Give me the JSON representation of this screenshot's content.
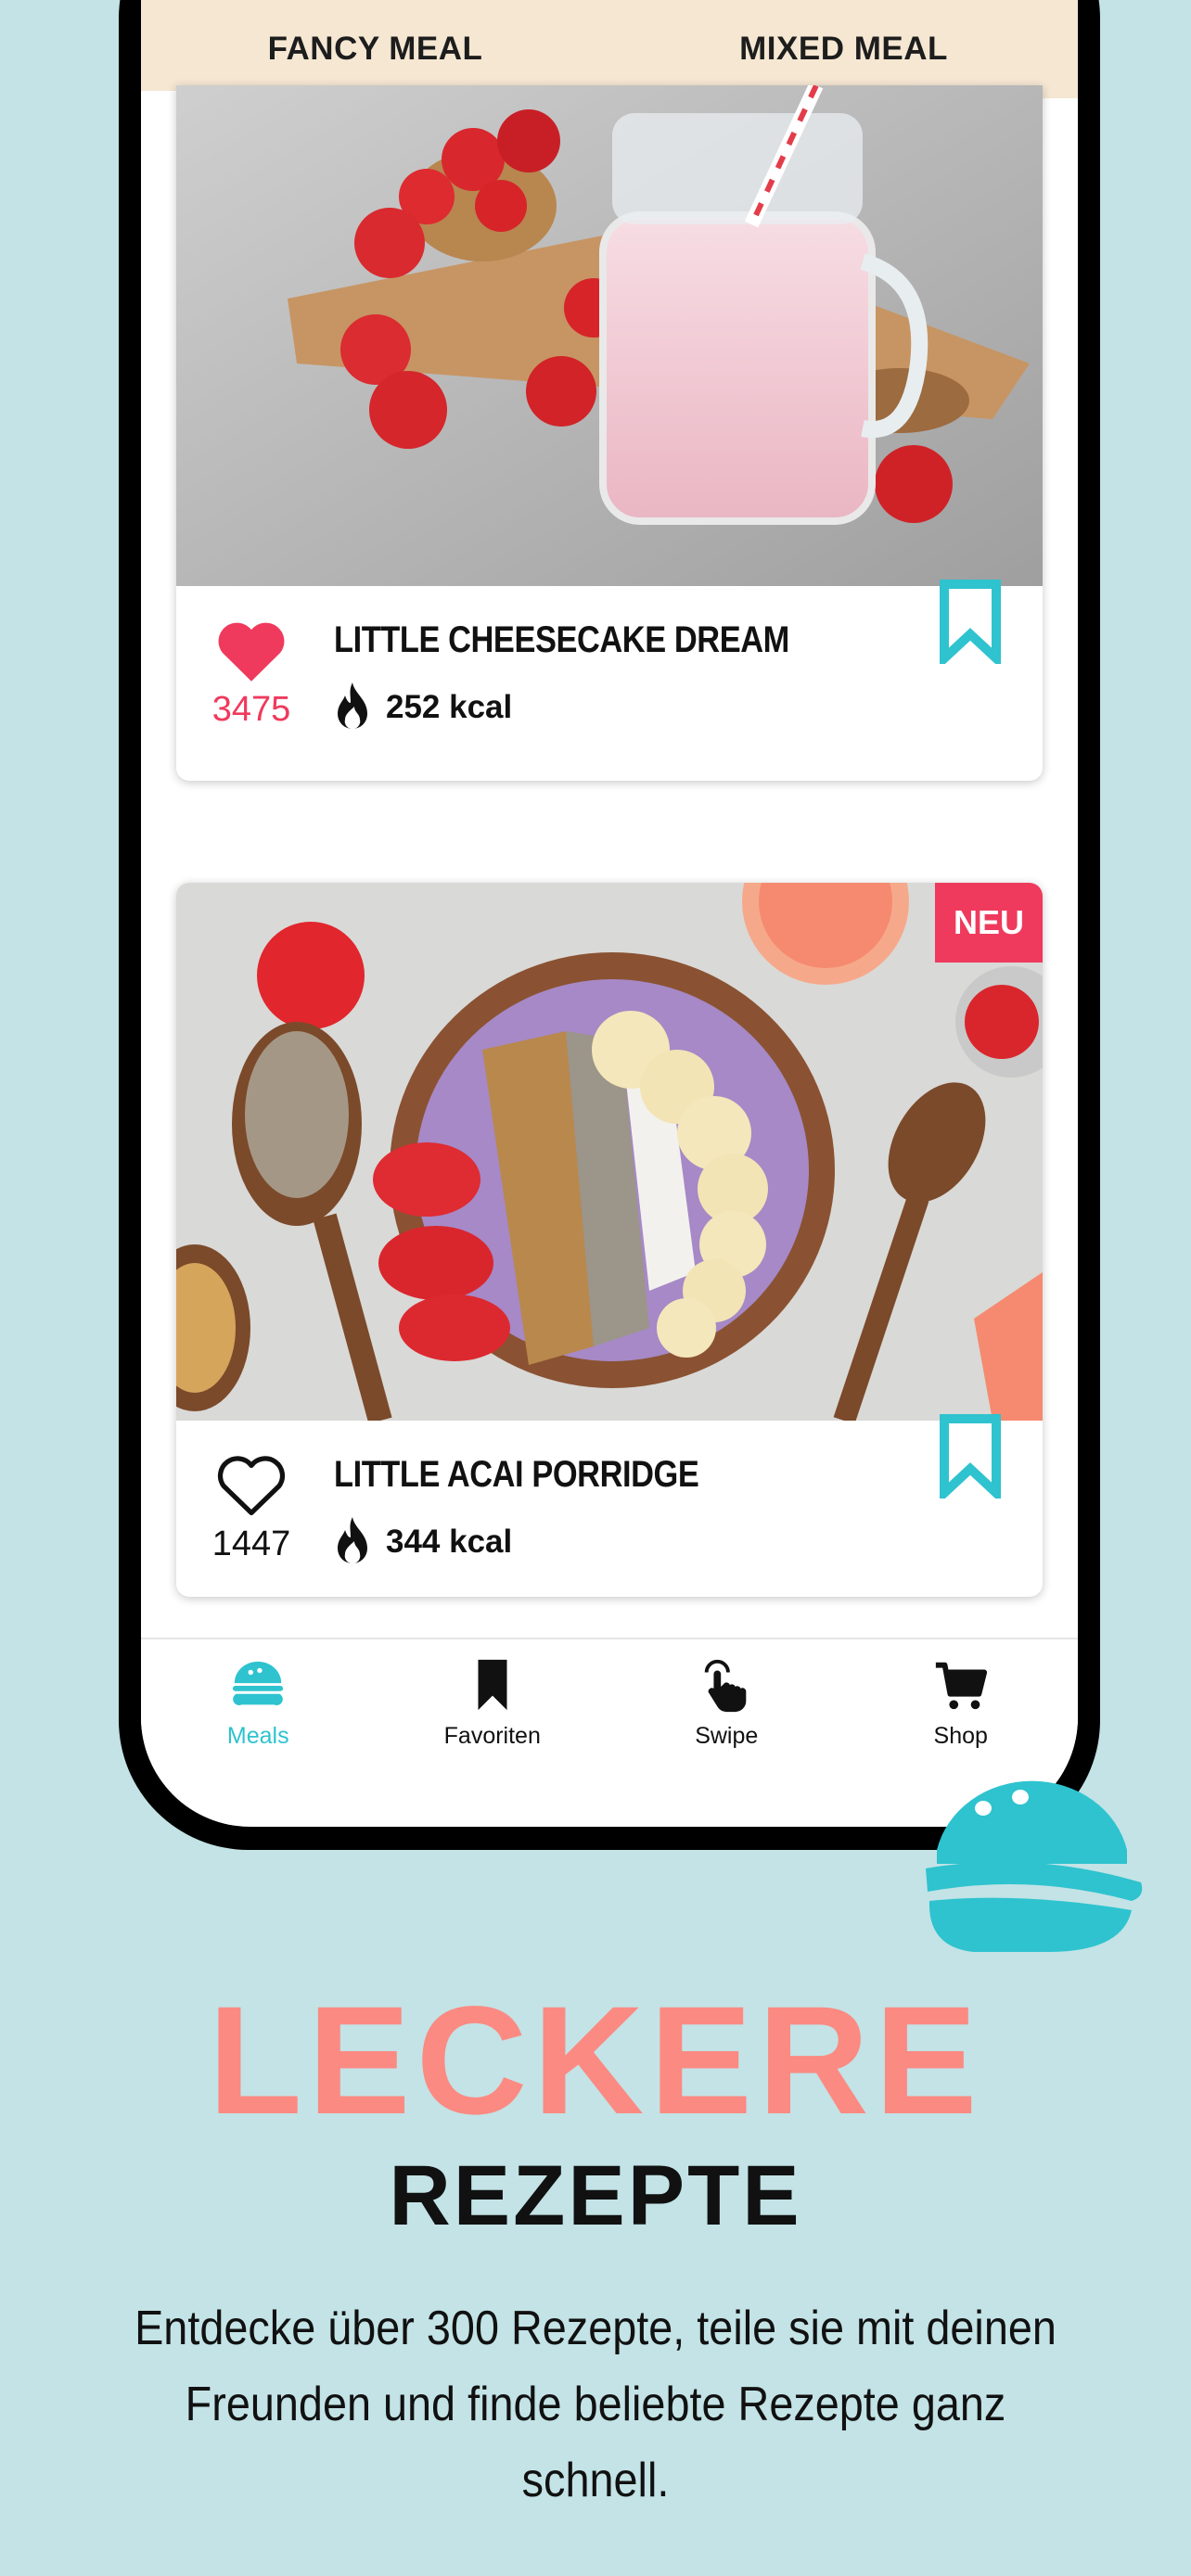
{
  "tabs": [
    {
      "label": "FANCY MEAL",
      "active": true
    },
    {
      "label": "MIXED MEAL",
      "active": false
    }
  ],
  "cards": [
    {
      "title": "LITTLE CHEESECAKE DREAM",
      "likes": "3475",
      "liked": true,
      "kcal": "252 kcal",
      "badge": ""
    },
    {
      "title": "LITTLE ACAI PORRIDGE",
      "likes": "1447",
      "liked": false,
      "kcal": "344 kcal",
      "badge": "NEU"
    }
  ],
  "nav": [
    {
      "label": "Meals",
      "icon": "burger-icon",
      "active": true
    },
    {
      "label": "Favoriten",
      "icon": "bookmark-icon",
      "active": false
    },
    {
      "label": "Swipe",
      "icon": "swipe-hand-icon",
      "active": false
    },
    {
      "label": "Shop",
      "icon": "cart-icon",
      "active": false
    }
  ],
  "promo": {
    "headline1": "LECKERE",
    "headline2": "REZEPTE",
    "description_line1": "Entdecke über 300 Rezepte, teile sie mit deinen",
    "description_line2": "Freunden und finde beliebte Rezepte ganz schnell."
  },
  "colors": {
    "background": "#c3e3e6",
    "tab_bar": "#f5e7d2",
    "accent_pink": "#ef3a5d",
    "accent_teal": "#2ec3cf",
    "headline_coral": "#fb8a82"
  }
}
